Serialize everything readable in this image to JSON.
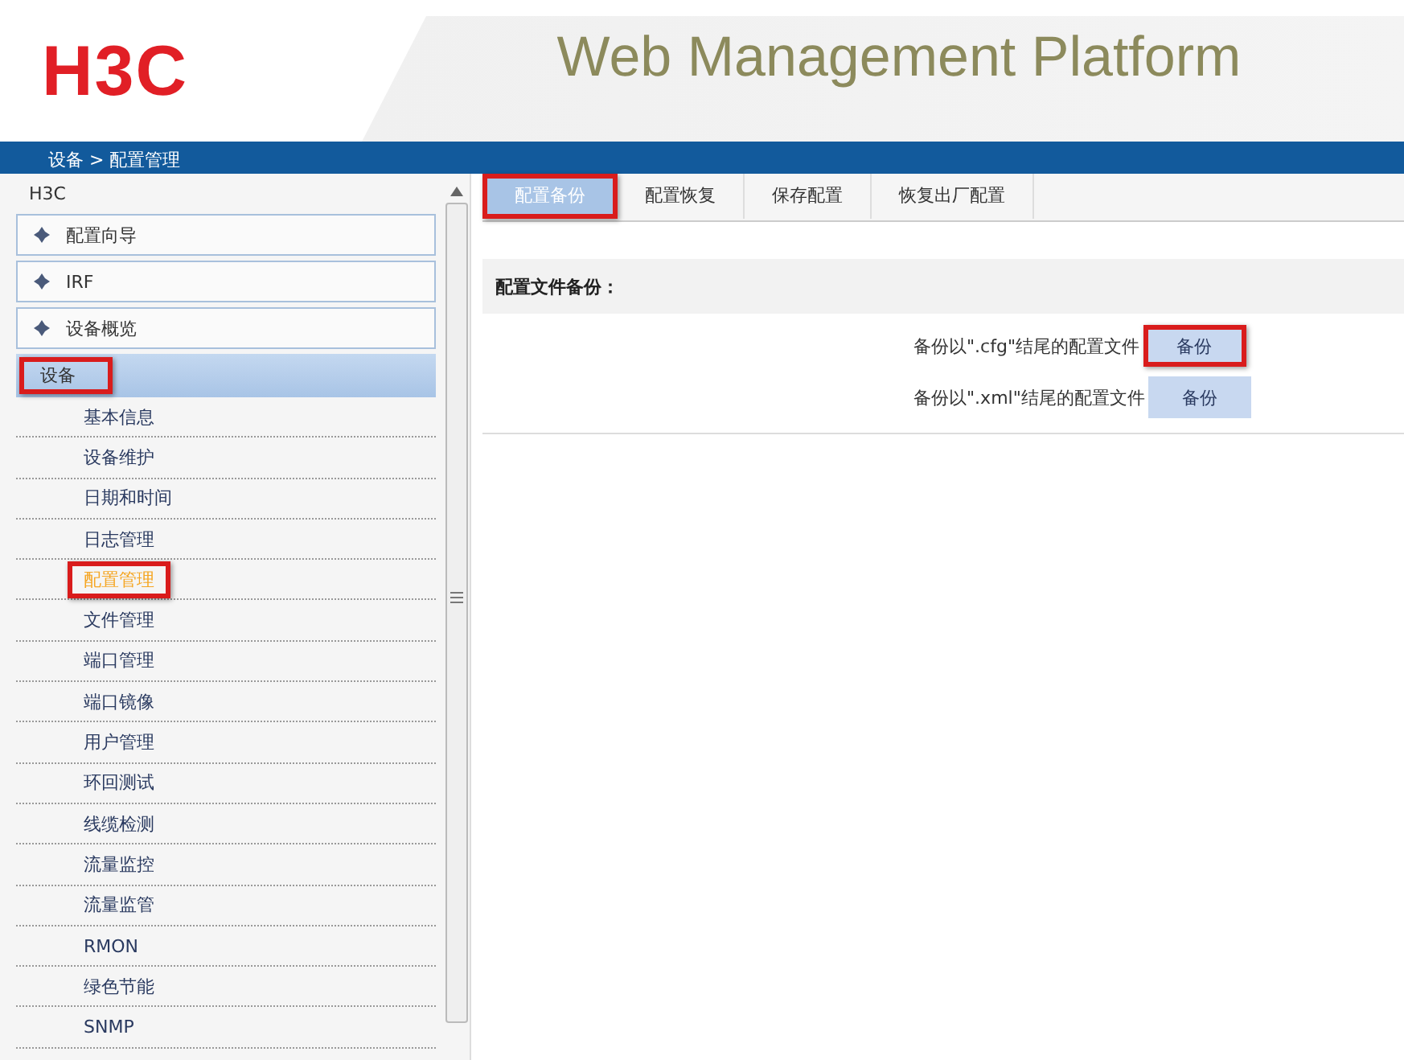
{
  "header": {
    "logo": "H3C",
    "title": "Web Management Platform"
  },
  "breadcrumb": "设备 > 配置管理",
  "sidebar": {
    "root": "H3C",
    "sections": [
      {
        "label": "配置向导"
      },
      {
        "label": "IRF"
      },
      {
        "label": "设备概览"
      }
    ],
    "group": {
      "label": "设备",
      "annotated": true
    },
    "items": [
      {
        "label": "基本信息",
        "selected": false,
        "annotated": false
      },
      {
        "label": "设备维护",
        "selected": false,
        "annotated": false
      },
      {
        "label": "日期和时间",
        "selected": false,
        "annotated": false
      },
      {
        "label": "日志管理",
        "selected": false,
        "annotated": false
      },
      {
        "label": "配置管理",
        "selected": true,
        "annotated": true
      },
      {
        "label": "文件管理",
        "selected": false,
        "annotated": false
      },
      {
        "label": "端口管理",
        "selected": false,
        "annotated": false
      },
      {
        "label": "端口镜像",
        "selected": false,
        "annotated": false
      },
      {
        "label": "用户管理",
        "selected": false,
        "annotated": false
      },
      {
        "label": "环回测试",
        "selected": false,
        "annotated": false
      },
      {
        "label": "线缆检测",
        "selected": false,
        "annotated": false
      },
      {
        "label": "流量监控",
        "selected": false,
        "annotated": false
      },
      {
        "label": "流量监管",
        "selected": false,
        "annotated": false
      },
      {
        "label": "RMON",
        "selected": false,
        "annotated": false
      },
      {
        "label": "绿色节能",
        "selected": false,
        "annotated": false
      },
      {
        "label": "SNMP",
        "selected": false,
        "annotated": false
      }
    ]
  },
  "tabs": [
    {
      "label": "配置备份",
      "selected": true,
      "annotated": true
    },
    {
      "label": "配置恢复",
      "selected": false,
      "annotated": false
    },
    {
      "label": "保存配置",
      "selected": false,
      "annotated": false
    },
    {
      "label": "恢复出厂配置",
      "selected": false,
      "annotated": false
    }
  ],
  "panel": {
    "heading": "配置文件备份：",
    "rows": [
      {
        "label": "备份以\".cfg\"结尾的配置文件",
        "button": "备份",
        "annotated": true
      },
      {
        "label": "备份以\".xml\"结尾的配置文件",
        "button": "备份",
        "annotated": false
      }
    ]
  }
}
